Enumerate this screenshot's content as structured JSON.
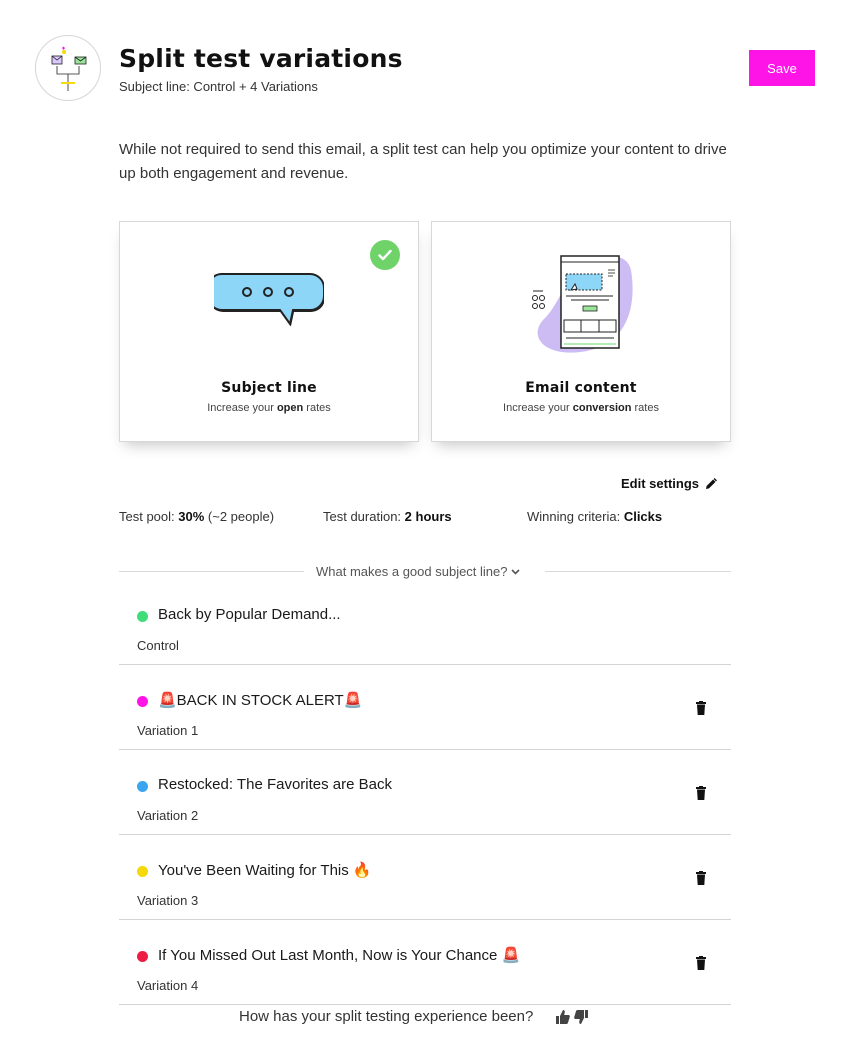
{
  "header": {
    "title": "Split test variations",
    "subtitle": "Subject line: Control + 4 Variations",
    "save_label": "Save"
  },
  "intro": "While not required to send this email, a split test can help you optimize your content to drive up both engagement and revenue.",
  "cards": {
    "subject": {
      "title": "Subject line",
      "desc_pre": "Increase your ",
      "desc_bold": "open",
      "desc_post": " rates",
      "selected": true
    },
    "email": {
      "title": "Email content",
      "desc_pre": "Increase your ",
      "desc_bold": "conversion",
      "desc_post": " rates",
      "selected": false
    }
  },
  "edit_settings_label": "Edit settings",
  "stats": {
    "pool_label": "Test pool: ",
    "pool_value": "30%",
    "pool_suffix": " (~2 people)",
    "duration_label": "Test duration: ",
    "duration_value": "2 hours",
    "criteria_label": "Winning criteria: ",
    "criteria_value": "Clicks"
  },
  "good_subject_label": "What makes a good subject line?",
  "variations": [
    {
      "text": "Back by Popular Demand...",
      "label": "Control",
      "color": "#3fdc7a",
      "deletable": false
    },
    {
      "text": "🚨BACK IN STOCK ALERT🚨",
      "label": "Variation 1",
      "color": "#ff14e8",
      "deletable": true
    },
    {
      "text": "Restocked: The Favorites are Back",
      "label": "Variation 2",
      "color": "#3aa6f0",
      "deletable": true
    },
    {
      "text": "You've Been Waiting for This 🔥",
      "label": "Variation 3",
      "color": "#f5d90a",
      "deletable": true
    },
    {
      "text": "If You Missed Out Last Month, Now is Your Chance 🚨",
      "label": "Variation 4",
      "color": "#ee1b45",
      "deletable": true
    }
  ],
  "feedback_question": "How has your split testing experience been?",
  "colors": {
    "accent": "#ff14e8",
    "check": "#6fd36a"
  }
}
